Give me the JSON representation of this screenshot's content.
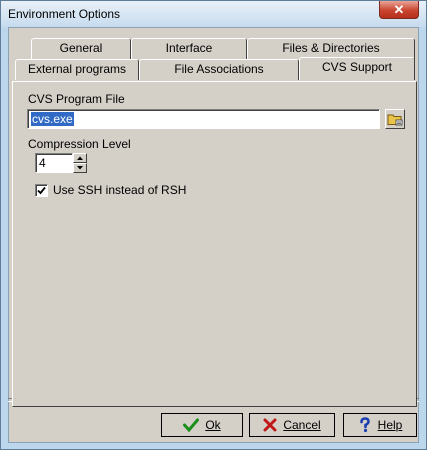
{
  "window": {
    "title": "Environment Options",
    "close_label": "✕"
  },
  "tabs": {
    "row_back": [
      {
        "label": "General"
      },
      {
        "label": "Interface"
      },
      {
        "label": "Files & Directories"
      }
    ],
    "row_front": [
      {
        "label": "External programs"
      },
      {
        "label": "File Associations"
      },
      {
        "label": "CVS Support",
        "active": true
      }
    ]
  },
  "cvs": {
    "program_file_label": "CVS Program File",
    "program_file_value": "cvs.exe",
    "compression_label": "Compression Level",
    "compression_value": "4",
    "ssh_label": "Use SSH instead of RSH",
    "ssh_checked": true
  },
  "buttons": {
    "ok": "Ok",
    "cancel": "Cancel",
    "help": "Help"
  },
  "colors": {
    "ok_icon": "#1a8f1a",
    "cancel_icon": "#c01818",
    "help_icon": "#1a3fb0"
  }
}
